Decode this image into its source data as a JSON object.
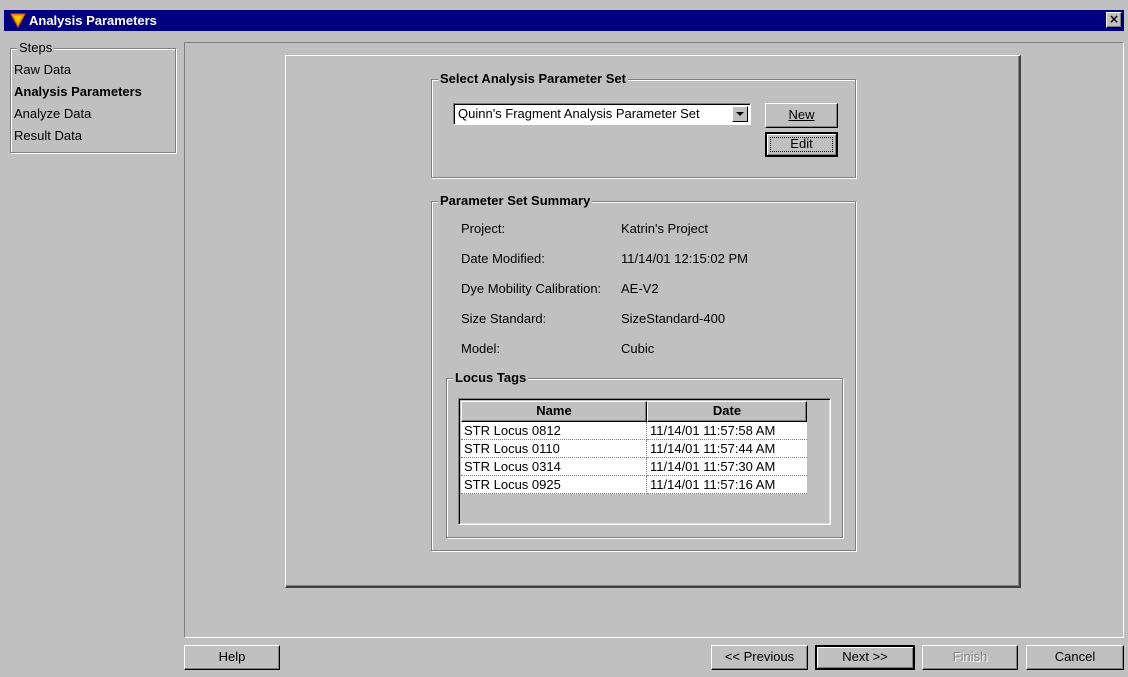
{
  "window": {
    "title": "Analysis Parameters",
    "close_glyph": "×"
  },
  "steps": {
    "legend": "Steps",
    "items": [
      {
        "label": "Raw Data",
        "active": false
      },
      {
        "label": "Analysis Parameters",
        "active": true
      },
      {
        "label": "Analyze Data",
        "active": false
      },
      {
        "label": "Result Data",
        "active": false
      }
    ]
  },
  "select_set": {
    "legend": "Select Analysis Parameter Set",
    "selected": "Quinn's Fragment Analysis Parameter Set",
    "new_label": "New",
    "edit_label": "Edit"
  },
  "summary": {
    "legend": "Parameter Set Summary",
    "fields": [
      {
        "label": "Project:",
        "value": "Katrin's Project"
      },
      {
        "label": "Date Modified:",
        "value": "11/14/01 12:15:02 PM"
      },
      {
        "label": "Dye Mobility Calibration:",
        "value": "AE-V2"
      },
      {
        "label": "Size Standard:",
        "value": "SizeStandard-400"
      },
      {
        "label": "Model:",
        "value": "Cubic"
      }
    ]
  },
  "locus_tags": {
    "legend": "Locus Tags",
    "columns": [
      "Name",
      "Date"
    ],
    "rows": [
      [
        "STR Locus 0812",
        "11/14/01 11:57:58 AM"
      ],
      [
        "STR Locus 0110",
        "11/14/01 11:57:44 AM"
      ],
      [
        "STR Locus 0314",
        "11/14/01 11:57:30 AM"
      ],
      [
        "STR Locus 0925",
        "11/14/01 11:57:16 AM"
      ]
    ]
  },
  "buttons": {
    "help": "Help",
    "previous": "<< Previous",
    "next": "Next >>",
    "finish": "Finish",
    "cancel": "Cancel"
  },
  "colors": {
    "titlebar": "#000080",
    "face": "#c0c0c0"
  }
}
